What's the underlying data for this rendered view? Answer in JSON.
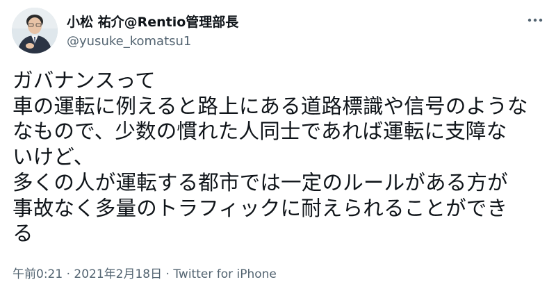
{
  "author": {
    "display_name": "小松 祐介@Rentio管理部長",
    "handle": "@yusuke_komatsu1"
  },
  "tweet": {
    "text": "ガバナンスって\n車の運転に例えると路上にある道路標識や信号のような\nなもので、少数の慣れた人同士であれば運転に支障な\nいけど、\n多くの人が運転する都市では一定のルールがある方が\n事故なく多量のトラフィックに耐えられることができ\nる"
  },
  "meta": {
    "time": "午前0:21",
    "separator1": " · ",
    "date": "2021年2月18日",
    "separator2": " · ",
    "source": "Twitter for iPhone"
  },
  "icons": {
    "avatar": "profile-photo",
    "more": "more-dots-icon"
  },
  "colors": {
    "text": "#0f1419",
    "secondary": "#536471",
    "background": "#ffffff"
  }
}
